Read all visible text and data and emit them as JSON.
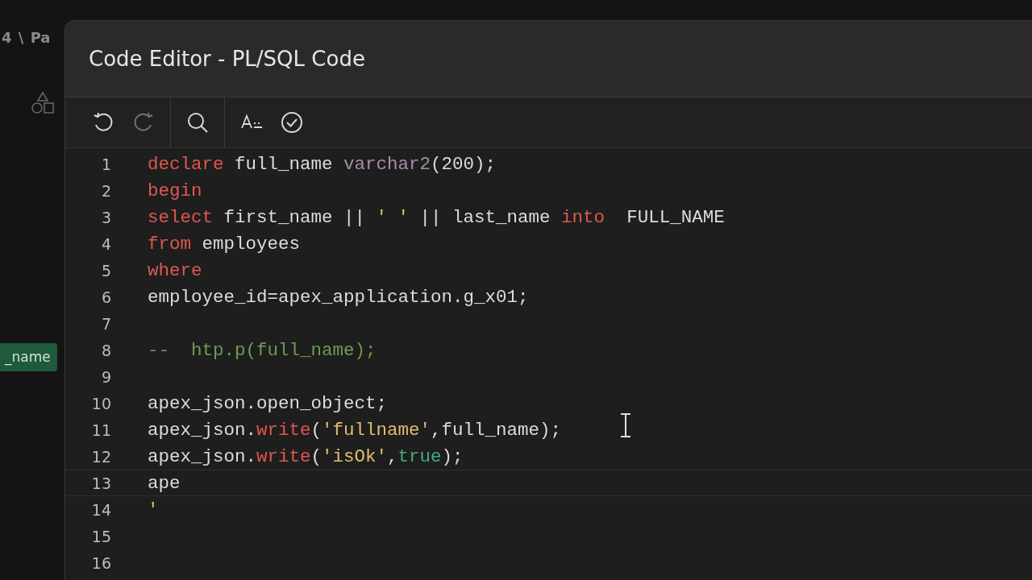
{
  "background": {
    "breadcrumb": "4 \\ Pa",
    "chip": "_name"
  },
  "dialog": {
    "title": "Code Editor - PL/SQL Code",
    "toolbar_groups": [
      [
        {
          "kind": "undo",
          "disabled": false
        },
        {
          "kind": "redo",
          "disabled": true
        }
      ],
      [
        {
          "kind": "search",
          "disabled": false
        }
      ],
      [
        {
          "kind": "autocomplete",
          "disabled": false
        },
        {
          "kind": "validate",
          "disabled": false
        }
      ]
    ],
    "lines": [
      {
        "number": "1",
        "current": false,
        "tokens": [
          {
            "kind": "keyword",
            "text": "declare"
          },
          {
            "kind": "plain",
            "text": " full_name "
          },
          {
            "kind": "type",
            "text": "varchar2"
          },
          {
            "kind": "plain",
            "text": "(200);"
          }
        ]
      },
      {
        "number": "2",
        "current": false,
        "tokens": [
          {
            "kind": "keyword",
            "text": "begin"
          }
        ]
      },
      {
        "number": "3",
        "current": false,
        "tokens": [
          {
            "kind": "keyword",
            "text": "select"
          },
          {
            "kind": "plain",
            "text": " first_name || "
          },
          {
            "kind": "string",
            "text": "' '"
          },
          {
            "kind": "plain",
            "text": " || last_name "
          },
          {
            "kind": "keyword",
            "text": "into"
          },
          {
            "kind": "plain",
            "text": "  FULL_NAME"
          }
        ]
      },
      {
        "number": "4",
        "current": false,
        "tokens": [
          {
            "kind": "keyword",
            "text": "from"
          },
          {
            "kind": "plain",
            "text": " employees"
          }
        ]
      },
      {
        "number": "5",
        "current": false,
        "tokens": [
          {
            "kind": "keyword",
            "text": "where"
          }
        ]
      },
      {
        "number": "6",
        "current": false,
        "tokens": [
          {
            "kind": "plain",
            "text": "employee_id=apex_application.g_x01;"
          }
        ]
      },
      {
        "number": "7",
        "current": false
      },
      {
        "number": "8",
        "current": false,
        "tokens": [
          {
            "kind": "comment",
            "text": "--  htp.p(full_name);"
          }
        ]
      },
      {
        "number": "9",
        "current": false
      },
      {
        "number": "10",
        "current": false,
        "tokens": [
          {
            "kind": "plain",
            "text": "apex_json.open_object;"
          }
        ]
      },
      {
        "number": "11",
        "current": false,
        "tokens": [
          {
            "kind": "plain",
            "text": "apex_json."
          },
          {
            "kind": "keyword",
            "text": "write"
          },
          {
            "kind": "plain",
            "text": "("
          },
          {
            "kind": "string",
            "text": "'fullname'"
          },
          {
            "kind": "plain",
            "text": ",full_name);"
          }
        ]
      },
      {
        "number": "12",
        "current": false,
        "tokens": [
          {
            "kind": "plain",
            "text": "apex_json."
          },
          {
            "kind": "keyword",
            "text": "write"
          },
          {
            "kind": "plain",
            "text": "("
          },
          {
            "kind": "string",
            "text": "'isOk'"
          },
          {
            "kind": "plain",
            "text": ","
          },
          {
            "kind": "bool",
            "text": "true"
          },
          {
            "kind": "plain",
            "text": ");"
          }
        ]
      },
      {
        "number": "13",
        "current": true,
        "tokens": [
          {
            "kind": "plain",
            "text": "ape"
          }
        ]
      },
      {
        "number": "14",
        "current": false,
        "tokens": [
          {
            "kind": "string",
            "text": "'"
          }
        ]
      },
      {
        "number": "15",
        "current": false
      },
      {
        "number": "16",
        "current": false
      }
    ]
  }
}
